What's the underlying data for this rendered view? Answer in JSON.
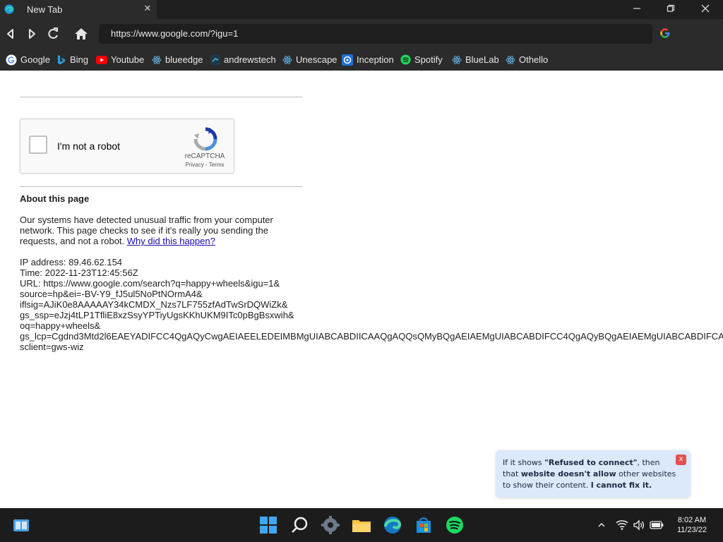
{
  "browser": {
    "tab_title": "New Tab",
    "tab_close": "✕",
    "address": "https://www.google.com/?igu=1",
    "bookmarks": [
      {
        "label": "Google"
      },
      {
        "label": "Bing"
      },
      {
        "label": "Youtube"
      },
      {
        "label": "blueedge"
      },
      {
        "label": "andrewstech"
      },
      {
        "label": "Unescape"
      },
      {
        "label": "Inception"
      },
      {
        "label": "Spotify"
      },
      {
        "label": "BlueLab"
      },
      {
        "label": "Othello"
      }
    ]
  },
  "captcha": {
    "label": "I'm not a robot",
    "brand": "reCAPTCHA",
    "privacy": "Privacy",
    "sep": " - ",
    "terms": "Terms"
  },
  "about": {
    "heading": "About this page",
    "body": "Our systems have detected unusual traffic from your computer network. This page checks to see if it's really you sending the requests, and not a robot.",
    "link": "Why did this happen?"
  },
  "info": {
    "ip": "IP address: 89.46.62.154",
    "time": "Time: 2022-11-23T12:45:56Z",
    "url_lines": [
      "URL: https://www.google.com/search?q=happy+wheels&igu=1&",
      "source=hp&ei=-BV-Y9_fJ5ul5NoPtNOrmA4&",
      "iflsig=AJiK0e8AAAAAY34kCMDX_Nzs7LF755zfAdTwSrDQWiZk&",
      "gs_ssp=eJzj4tLP1TfliE8xzSsyYPTiyUgsKKhUKM9ITc0pBgBsxwih&",
      "oq=happy+wheels&",
      "gs_lcp=Cgdnd3Mtd2l6EAEYADIFCC4QgAQyCwgAEIAEELEDEIMBMgUIABCABDIICAAQgAQQsQMyBQgAEIAEMgUIABCABDIFCC4QgAQyBQgAEIAEMgUIABCABDIFCA",
      "sclient=gws-wiz"
    ]
  },
  "notice": {
    "p1": "If it shows ",
    "b1": "\"Refused to connect\"",
    "p2": ", then that ",
    "b2": "website doesn't allow",
    "p3": " other websites to show their content. ",
    "b3": "I cannot fix it.",
    "close": "x"
  },
  "taskbar": {
    "time": "8:02 AM",
    "date": "11/23/22"
  },
  "colors": {
    "chrome_bg": "#2b2b2b",
    "titlebar_bg": "#1f1f1f",
    "link": "#1a0dab",
    "notice_bg": "#dbe9fb",
    "taskbar_bg": "#1c1c1c"
  }
}
